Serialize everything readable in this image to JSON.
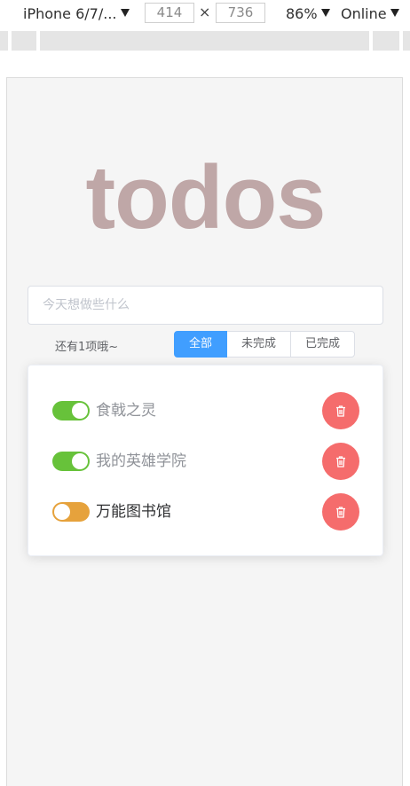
{
  "devtools": {
    "device": "iPhone 6/7/...",
    "width": "414",
    "height": "736",
    "zoom": "86%",
    "network": "Online"
  },
  "app": {
    "title": "todos",
    "input_placeholder": "今天想做些什么",
    "remaining_text": "还有1项哦~",
    "filters": [
      "全部",
      "未完成",
      "已完成"
    ],
    "active_filter": "全部",
    "todos": [
      {
        "text": "食戟之灵",
        "done": true
      },
      {
        "text": "我的英雄学院",
        "done": true
      },
      {
        "text": "万能图书馆",
        "done": false
      }
    ]
  },
  "colors": {
    "switch_on": "#67c23a",
    "switch_off": "#e6a23c",
    "delete": "#f56c6c",
    "primary": "#409eff",
    "done_text": "#909399",
    "pending_text": "#303133"
  }
}
